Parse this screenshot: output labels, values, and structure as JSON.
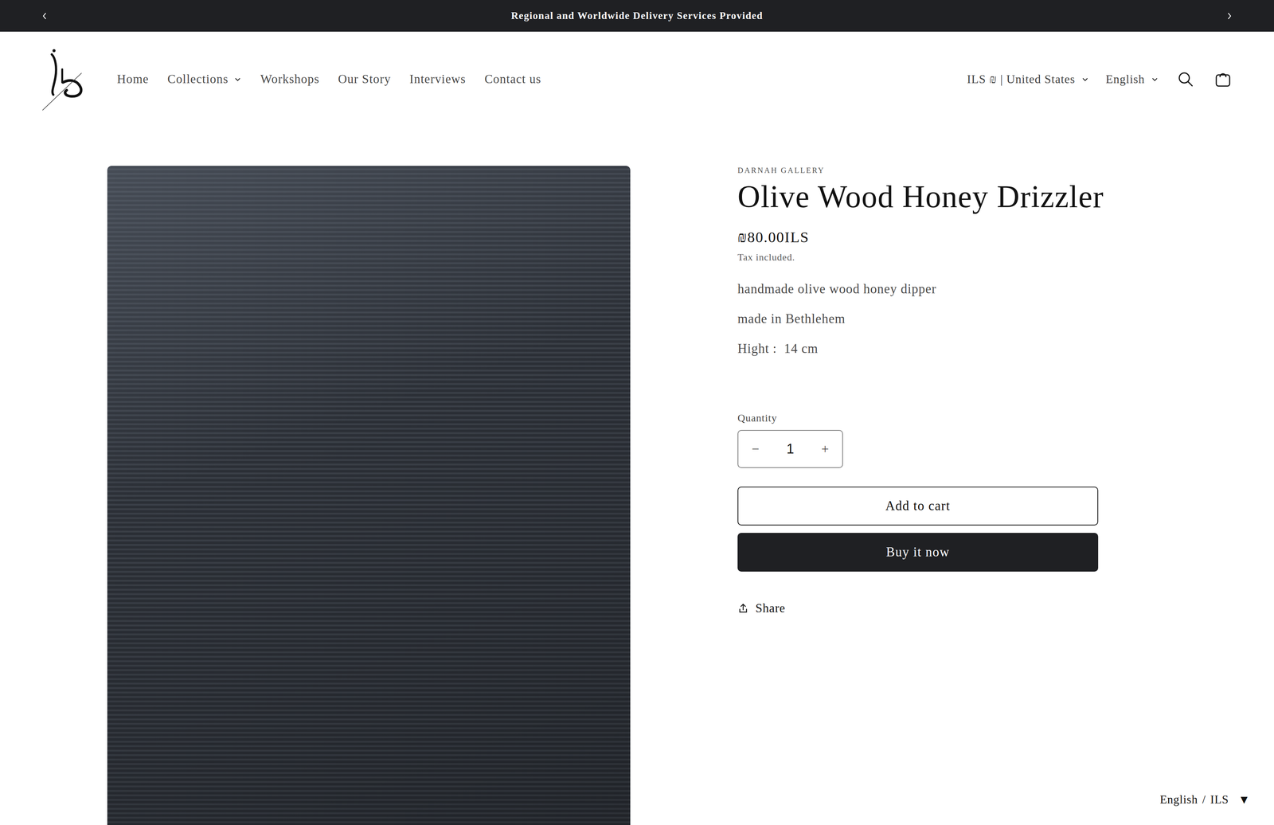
{
  "announcement": {
    "text": "Regional and Worldwide Delivery Services Provided"
  },
  "nav": [
    {
      "label": "Home",
      "dropdown": false
    },
    {
      "label": "Collections",
      "dropdown": true
    },
    {
      "label": "Workshops",
      "dropdown": false
    },
    {
      "label": "Our Story",
      "dropdown": false
    },
    {
      "label": "Interviews",
      "dropdown": false
    },
    {
      "label": "Contact us",
      "dropdown": false
    }
  ],
  "localization": {
    "country": "ILS ₪ | United States",
    "language": "English"
  },
  "product": {
    "vendor": "DARNAH GALLERY",
    "title": "Olive Wood Honey Drizzler",
    "price": "₪80.00ILS",
    "tax_note": "Tax included.",
    "description": [
      "handmade olive wood honey dipper",
      "made in Bethlehem",
      "Hight :  14 cm"
    ],
    "quantity": {
      "label": "Quantity",
      "value": "1",
      "decrease": "−",
      "increase": "+"
    },
    "add_to_cart": "Add to cart",
    "buy_now": "Buy it now",
    "share": "Share"
  },
  "widget": {
    "language": "English",
    "separator": "/",
    "currency": "ILS",
    "arrow": "▼"
  }
}
